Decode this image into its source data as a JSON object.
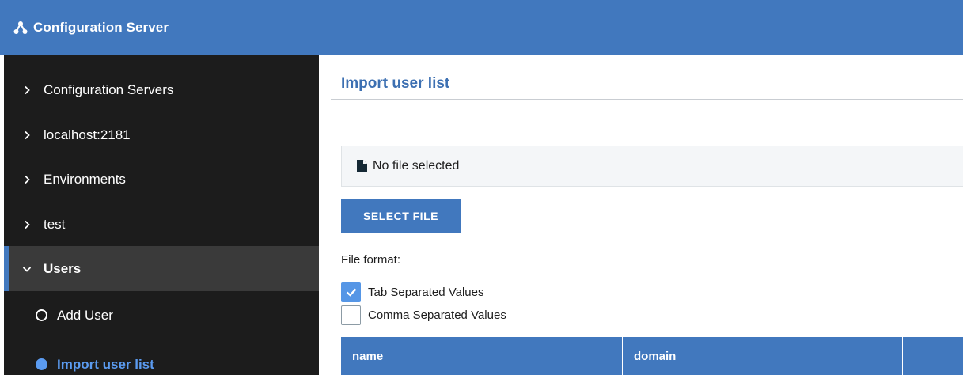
{
  "app": {
    "title": "Configuration Server"
  },
  "sidebar": {
    "items": [
      {
        "label": "Configuration Servers"
      },
      {
        "label": "localhost:2181"
      },
      {
        "label": "Environments"
      },
      {
        "label": "test"
      },
      {
        "label": "Users",
        "expanded": true
      }
    ],
    "subitems": [
      {
        "label": "Add User",
        "selected": false
      },
      {
        "label": "Import user list",
        "selected": true
      }
    ]
  },
  "main": {
    "title": "Import user list",
    "file_status": "No file selected",
    "select_button": "SELECT FILE",
    "format_label": "File format:",
    "formats": [
      {
        "label": "Tab Separated Values",
        "checked": true
      },
      {
        "label": "Comma Separated Values",
        "checked": false
      }
    ],
    "table": {
      "headers": [
        "name",
        "domain",
        ""
      ]
    }
  },
  "colors": {
    "accent": "#4178be",
    "sidebar": "#1c1c1c",
    "selected": "#5b9bf0"
  },
  "icons": [
    "graph-logo-icon",
    "chevron-right-icon",
    "chevron-down-icon",
    "radio-icon",
    "file-icon",
    "checkmark-icon"
  ]
}
